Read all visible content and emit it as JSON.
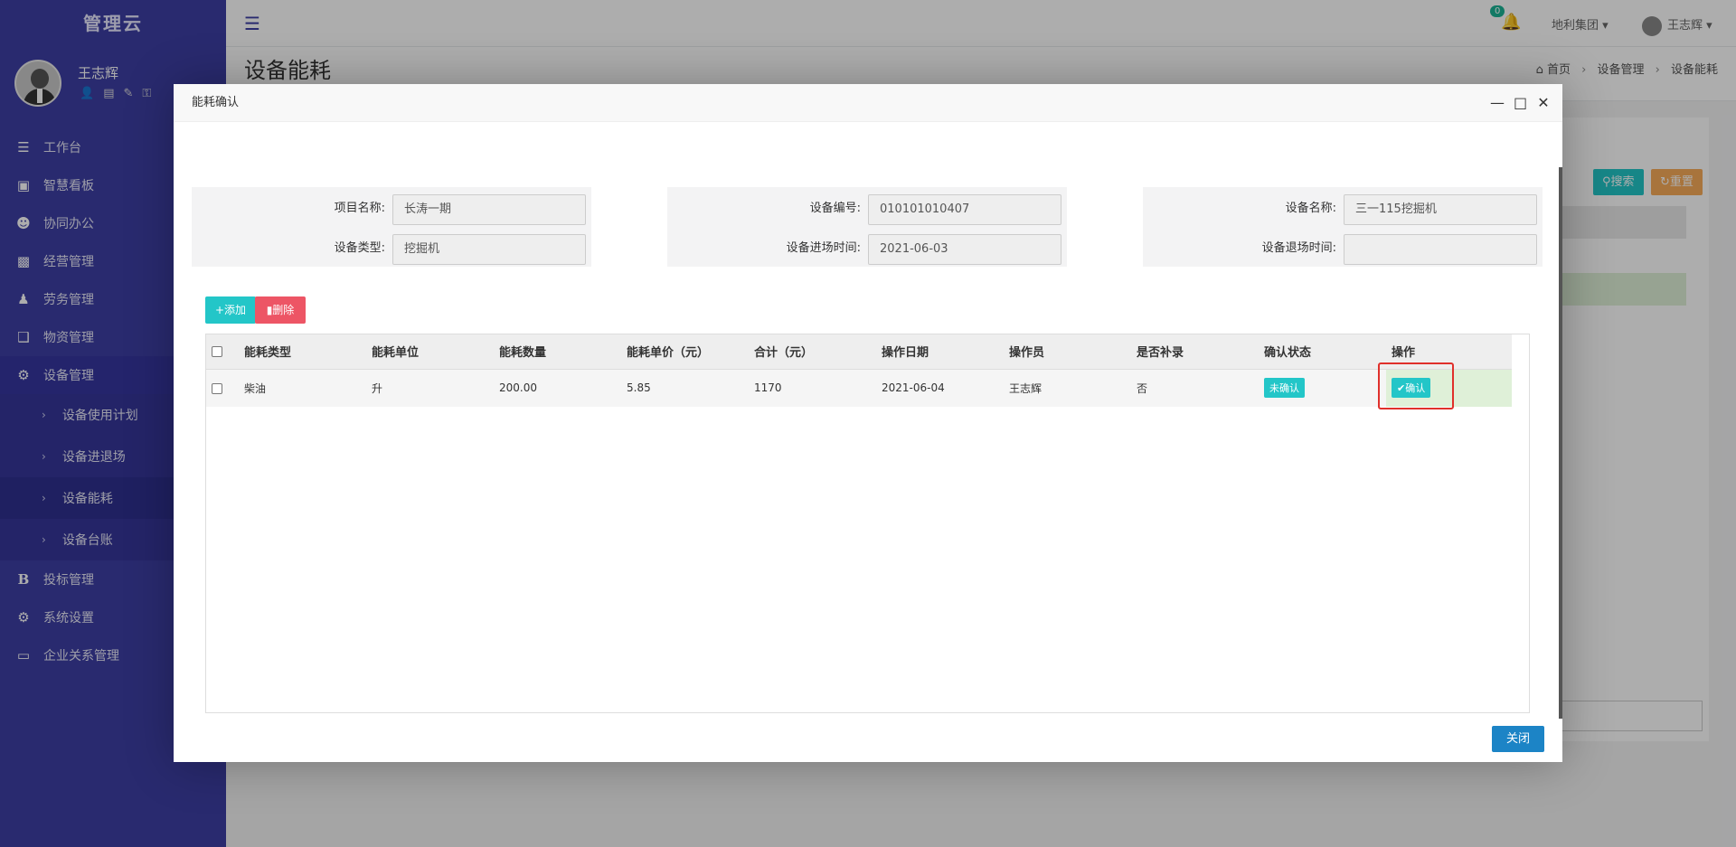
{
  "sidebar": {
    "brand": "管理云",
    "user": "王志辉",
    "profile_icons": [
      "user-icon",
      "id-card-icon",
      "edit-icon",
      "key-icon"
    ],
    "menu": [
      {
        "icon": "workbench-icon",
        "label": "工作台"
      },
      {
        "icon": "dashboard-icon",
        "label": "智慧看板"
      },
      {
        "icon": "team-icon",
        "label": "协同办公"
      },
      {
        "icon": "bar-chart-icon",
        "label": "经营管理"
      },
      {
        "icon": "worker-icon",
        "label": "劳务管理"
      },
      {
        "icon": "cube-icon",
        "label": "物资管理"
      },
      {
        "icon": "cogs-icon",
        "label": "设备管理"
      }
    ],
    "submenu": [
      {
        "label": "设备使用计划"
      },
      {
        "label": "设备进退场"
      },
      {
        "label": "设备能耗"
      },
      {
        "label": "设备台账"
      }
    ],
    "menu_bottom": [
      {
        "icon": "bold-b-icon",
        "label": "投标管理"
      },
      {
        "icon": "gear-icon",
        "label": "系统设置"
      },
      {
        "icon": "monitor-icon",
        "label": "企业关系管理"
      }
    ]
  },
  "topbar": {
    "notif_count": "0",
    "org": "地利集团",
    "user": "王志辉"
  },
  "page": {
    "title": "设备能耗",
    "breadcrumb": [
      "首页",
      "设备管理",
      "设备能耗"
    ],
    "search_label": "搜索",
    "reset_label": "重置"
  },
  "modal": {
    "title": "能耗确认",
    "form": {
      "project_name_label": "项目名称:",
      "project_name": "长涛一期",
      "device_code_label": "设备编号:",
      "device_code": "010101010407",
      "device_name_label": "设备名称:",
      "device_name": "三一115挖掘机",
      "device_type_label": "设备类型:",
      "device_type": "挖掘机",
      "entry_time_label": "设备进场时间:",
      "entry_time": "2021-06-03",
      "exit_time_label": "设备退场时间:",
      "exit_time": ""
    },
    "add_label": "+添加",
    "delete_label": "删除",
    "table": {
      "headers": [
        "能耗类型",
        "能耗单位",
        "能耗数量",
        "能耗单价（元）",
        "合计（元）",
        "操作日期",
        "操作员",
        "是否补录",
        "确认状态",
        "操作"
      ],
      "rows": [
        {
          "type": "柴油",
          "unit": "升",
          "qty": "200.00",
          "price": "5.85",
          "total": "1170",
          "date": "2021-06-04",
          "operator": "王志辉",
          "supplement": "否",
          "status": "未确认",
          "action": "✔确认"
        }
      ]
    },
    "close_label": "关闭"
  }
}
